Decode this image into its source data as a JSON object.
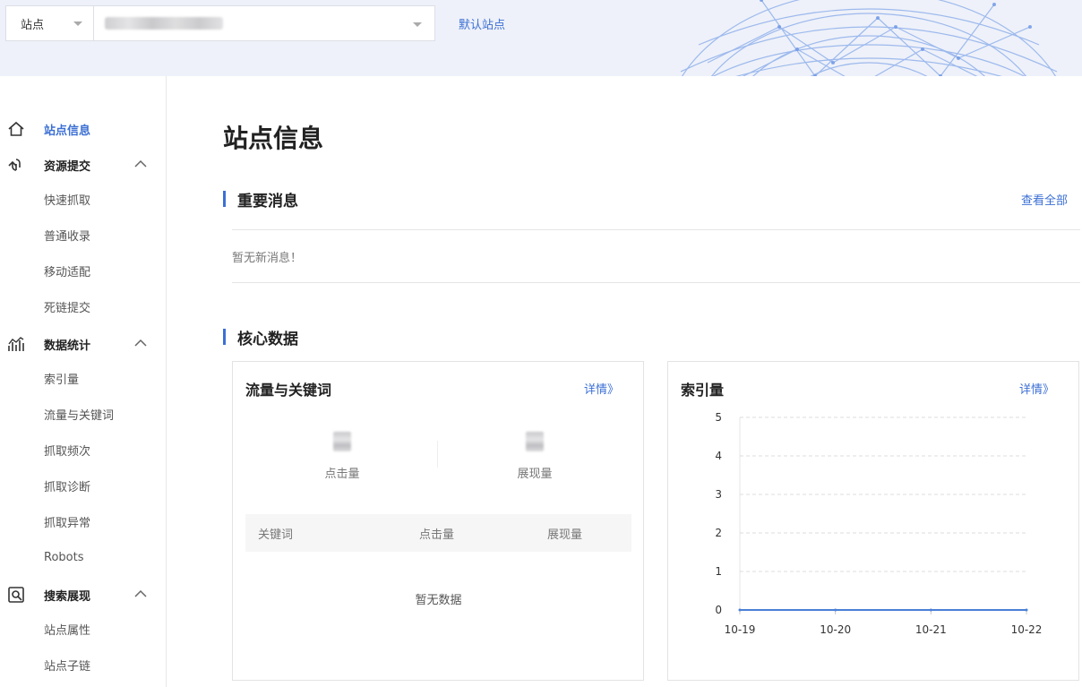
{
  "header": {
    "selector_type": "站点",
    "default_site_link": "默认站点"
  },
  "sidebar": {
    "items": [
      {
        "label": "站点信息",
        "kind": "top",
        "icon": "home-icon",
        "active": true
      },
      {
        "label": "资源提交",
        "kind": "group",
        "icon": "link-submit-icon"
      },
      {
        "label": "快速抓取",
        "kind": "sub"
      },
      {
        "label": "普通收录",
        "kind": "sub"
      },
      {
        "label": "移动适配",
        "kind": "sub"
      },
      {
        "label": "死链提交",
        "kind": "sub"
      },
      {
        "label": "数据统计",
        "kind": "group",
        "icon": "stats-icon"
      },
      {
        "label": "索引量",
        "kind": "sub"
      },
      {
        "label": "流量与关键词",
        "kind": "sub"
      },
      {
        "label": "抓取频次",
        "kind": "sub"
      },
      {
        "label": "抓取诊断",
        "kind": "sub"
      },
      {
        "label": "抓取异常",
        "kind": "sub"
      },
      {
        "label": "Robots",
        "kind": "sub"
      },
      {
        "label": "搜索展现",
        "kind": "group",
        "icon": "search-display-icon"
      },
      {
        "label": "站点属性",
        "kind": "sub"
      },
      {
        "label": "站点子链",
        "kind": "sub"
      }
    ]
  },
  "main": {
    "page_title": "站点信息",
    "messages": {
      "title": "重要消息",
      "view_all": "查看全部",
      "empty_text": "暂无新消息！"
    },
    "core": {
      "title": "核心数据",
      "traffic_card": {
        "title": "流量与关键词",
        "detail_link": "详情》",
        "metric_clicks_label": "点击量",
        "metric_impressions_label": "展现量",
        "table_headers": [
          "关键词",
          "点击量",
          "展现量"
        ],
        "table_empty": "暂无数据"
      },
      "index_card": {
        "title": "索引量",
        "detail_link": "详情》"
      }
    }
  },
  "colors": {
    "accent": "#3b6fd4",
    "header_bg": "#eef1f9"
  },
  "chart_data": {
    "type": "line",
    "title": "",
    "xlabel": "",
    "ylabel": "",
    "categories": [
      "10-19",
      "10-20",
      "10-21",
      "10-22"
    ],
    "series": [
      {
        "values": [
          0,
          0,
          0,
          0
        ]
      }
    ],
    "ylim": [
      0,
      5
    ],
    "yticks": [
      0,
      1,
      2,
      3,
      4,
      5
    ],
    "grid": true,
    "line_color": "#4a7fd6"
  }
}
